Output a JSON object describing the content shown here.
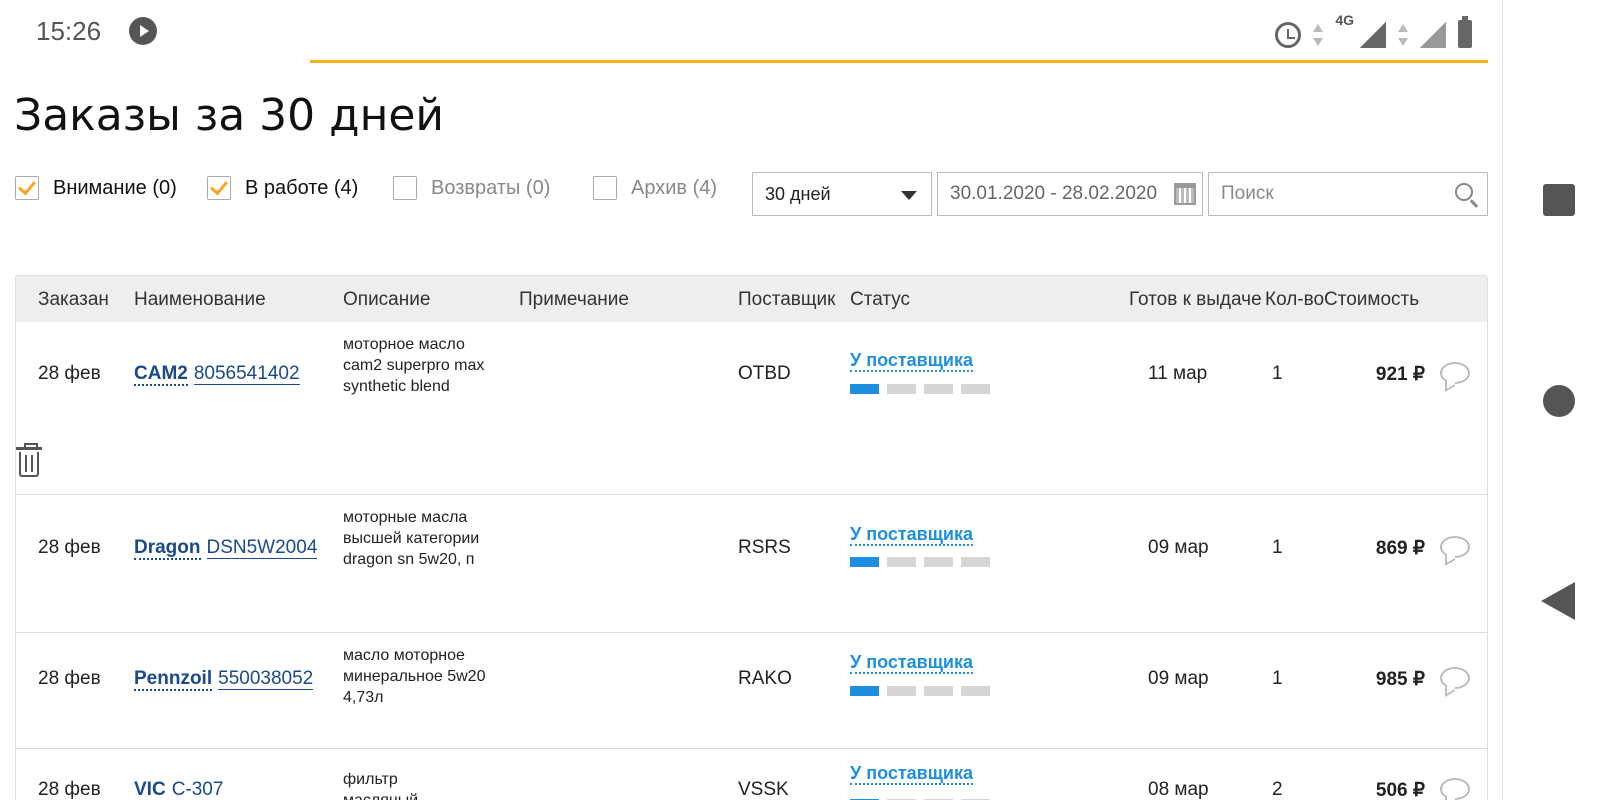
{
  "status_bar": {
    "time": "15:26",
    "network": "4G"
  },
  "title": "Заказы за 30 дней",
  "filters": [
    {
      "label": "Внимание (0)",
      "checked": true
    },
    {
      "label": "В работе (4)",
      "checked": true
    },
    {
      "label": "Возвраты (0)",
      "checked": false
    },
    {
      "label": "Архив (4)",
      "checked": false
    }
  ],
  "period": {
    "selected": "30 дней"
  },
  "date_range": "30.01.2020 - 28.02.2020",
  "search": {
    "placeholder": "Поиск"
  },
  "table": {
    "headers": [
      "Заказан",
      "Наименование",
      "Описание",
      "Примечание",
      "Поставщик",
      "Статус",
      "Готов к выдаче",
      "Кол-во",
      "Стоимость"
    ],
    "rows": [
      {
        "ordered": "28 фев",
        "brand": "CAM2",
        "code": "8056541402",
        "description": "моторное масло cam2 superpro max synthetic blend",
        "note": "",
        "supplier": "OTBD",
        "status": "У поставщика",
        "progress_step": 1,
        "ready": "11 мар",
        "qty": "1",
        "cost": "921 ₽"
      },
      {
        "ordered": "28 фев",
        "brand": "Dragon",
        "code": "DSN5W2004",
        "description": "моторные масла высшей категории dragon sn 5w20, п",
        "note": "",
        "supplier": "RSRS",
        "status": "У поставщика",
        "progress_step": 1,
        "ready": "09 мар",
        "qty": "1",
        "cost": "869 ₽"
      },
      {
        "ordered": "28 фев",
        "brand": "Pennzoil",
        "code": "550038052",
        "description": "масло моторное минеральное 5w20 4,73л",
        "note": "",
        "supplier": "RAKO",
        "status": "У поставщика",
        "progress_step": 1,
        "ready": "09 мар",
        "qty": "1",
        "cost": "985 ₽"
      },
      {
        "ordered": "28 фев",
        "brand": "VIC",
        "code": "C-307",
        "description": "фильтр масляный",
        "note": "",
        "supplier": "VSSK",
        "status": "У поставщика",
        "progress_step": 1,
        "ready": "08 мар",
        "qty": "2",
        "cost": "506 ₽"
      }
    ]
  }
}
